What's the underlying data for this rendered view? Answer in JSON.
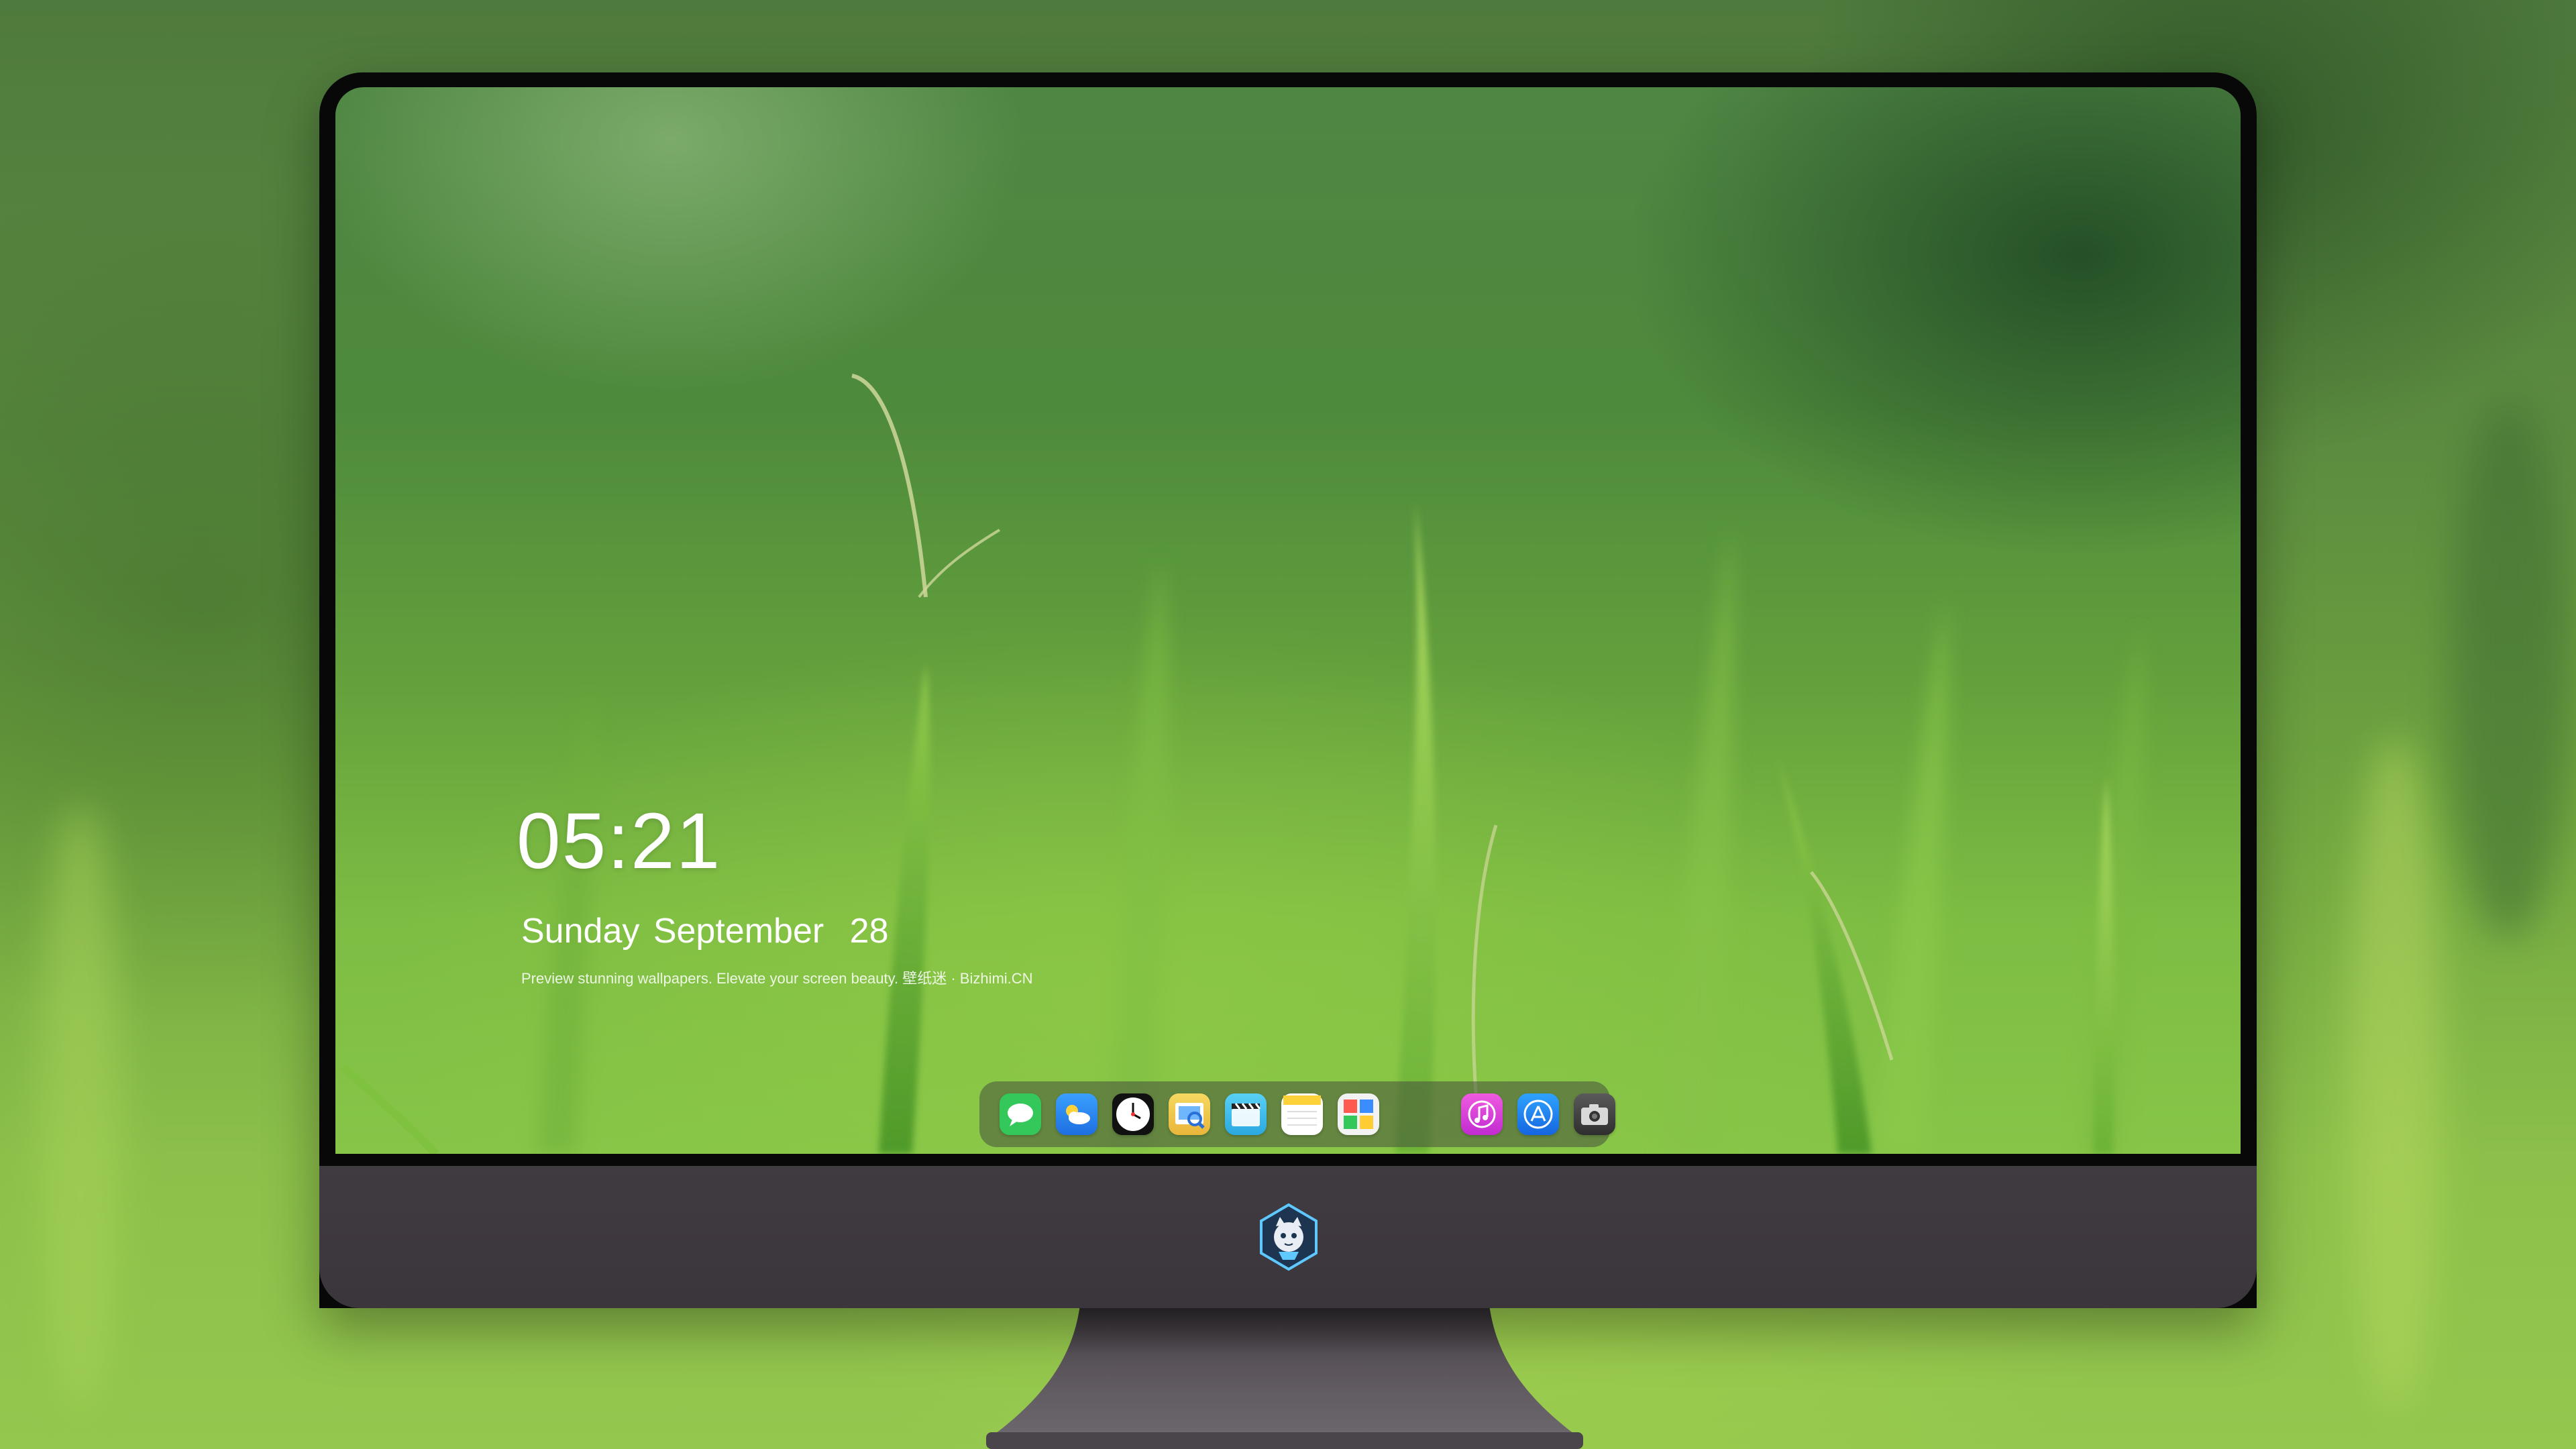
{
  "lockscreen": {
    "time": "05:21",
    "weekday": "Sunday",
    "month": "September",
    "day": "28",
    "tagline": "Preview stunning wallpapers. Elevate your screen beauty. 壁纸迷 · Bizhimi.CN"
  },
  "dock": {
    "apps": [
      {
        "name": "messages",
        "color": "#34c759"
      },
      {
        "name": "weather",
        "color": "#2f8fff"
      },
      {
        "name": "clock",
        "color": "#111111"
      },
      {
        "name": "preview",
        "color": "#f1c644"
      },
      {
        "name": "videos",
        "color": "#35b6e8"
      },
      {
        "name": "notes",
        "color": "#ffd84a"
      },
      {
        "name": "photo-booth",
        "color": "#e9e9e9"
      },
      {
        "name": "music",
        "color": "#e33bd5"
      },
      {
        "name": "app-store",
        "color": "#1a8cff"
      },
      {
        "name": "camera",
        "color": "#3a3a3a"
      }
    ]
  },
  "colors": {
    "bezel": "#080808",
    "chin": "#3e393e",
    "dock": "rgba(70,80,60,0.55)",
    "wallpaper_green": "#6fa43f"
  }
}
